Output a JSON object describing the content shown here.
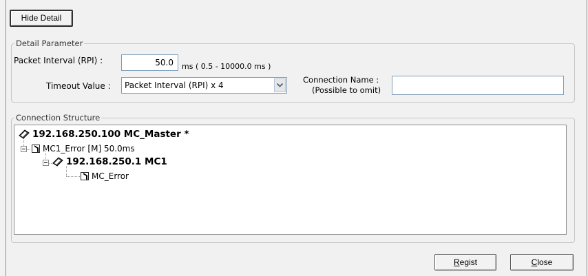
{
  "buttons": {
    "hide_detail": "Hide Detail",
    "regist_rest": "egist",
    "regist_key": "R",
    "close_rest": "lose",
    "close_key": "C"
  },
  "detail": {
    "group_title": "Detail Parameter",
    "rpi_label": "Packet Interval (RPI) :",
    "rpi_value": "50.0",
    "rpi_range": "ms ( 0.5 - 10000.0 ms )",
    "timeout_label": "Timeout Value :",
    "timeout_value": "Packet Interval (RPI) x 4",
    "conn_name_label": "Connection Name :",
    "conn_name_hint": "(Possible to omit)",
    "conn_name_value": ""
  },
  "structure": {
    "group_title": "Connection Structure",
    "nodes": [
      {
        "text": "192.168.250.100 MC_Master *",
        "icon": "device-icon"
      },
      {
        "text": "MC1_Error [M] 50.0ms",
        "icon": "tag-icon"
      },
      {
        "text": "192.168.250.1 MC1",
        "icon": "device-icon"
      },
      {
        "text": "MC_Error",
        "icon": "tag-icon"
      }
    ]
  }
}
